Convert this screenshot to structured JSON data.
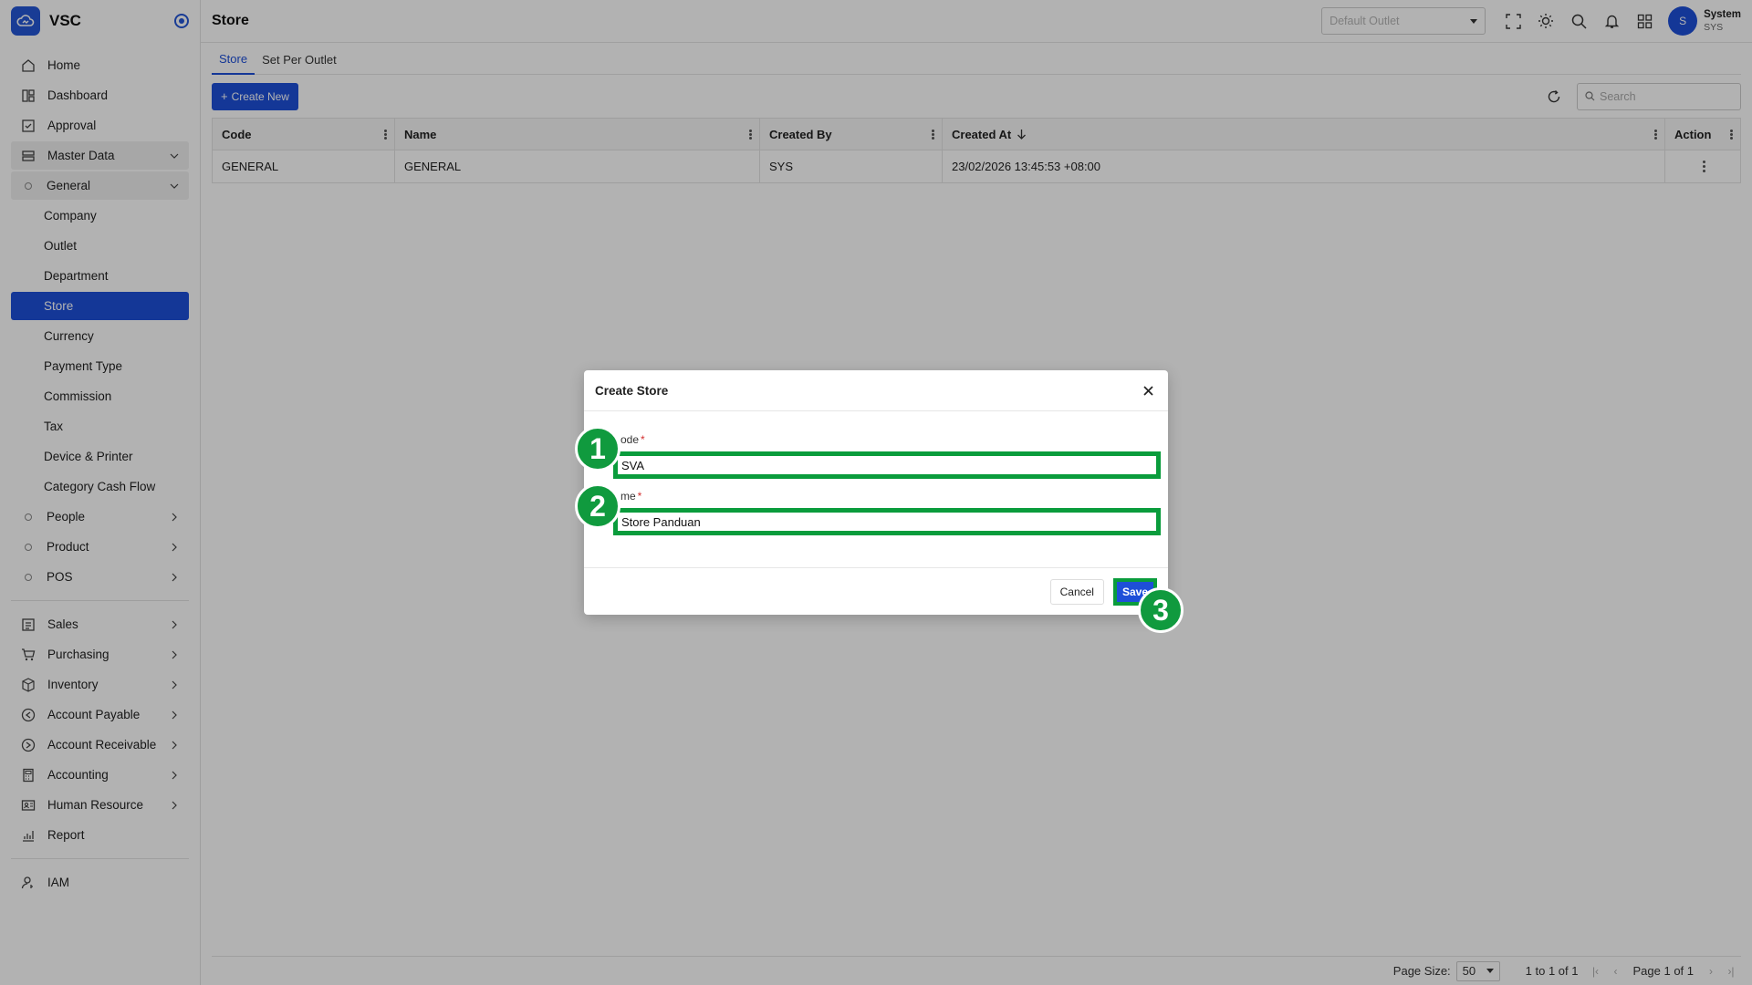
{
  "brand": {
    "name": "VSC"
  },
  "sidebar": {
    "items": [
      {
        "label": "Home",
        "icon": "home-icon"
      },
      {
        "label": "Dashboard",
        "icon": "dashboard-icon"
      },
      {
        "label": "Approval",
        "icon": "approval-icon"
      },
      {
        "label": "Master Data",
        "icon": "master-data-icon"
      },
      {
        "label": "General"
      },
      {
        "label": "Company"
      },
      {
        "label": "Outlet"
      },
      {
        "label": "Department"
      },
      {
        "label": "Store"
      },
      {
        "label": "Currency"
      },
      {
        "label": "Payment Type"
      },
      {
        "label": "Commission"
      },
      {
        "label": "Tax"
      },
      {
        "label": "Device & Printer"
      },
      {
        "label": "Category Cash Flow"
      },
      {
        "label": "People"
      },
      {
        "label": "Product"
      },
      {
        "label": "POS"
      },
      {
        "label": "Sales",
        "icon": "sales-icon"
      },
      {
        "label": "Purchasing",
        "icon": "cart-icon"
      },
      {
        "label": "Inventory",
        "icon": "box-icon"
      },
      {
        "label": "Account Payable",
        "icon": "payable-icon"
      },
      {
        "label": "Account Receivable",
        "icon": "receivable-icon"
      },
      {
        "label": "Accounting",
        "icon": "calculator-icon"
      },
      {
        "label": "Human Resource",
        "icon": "id-card-icon"
      },
      {
        "label": "Report",
        "icon": "report-icon"
      },
      {
        "label": "IAM",
        "icon": "user-key-icon"
      }
    ]
  },
  "header": {
    "title": "Store",
    "outlet_placeholder": "Default Outlet",
    "user_name": "System",
    "user_role": "SYS",
    "avatar_initial": "S"
  },
  "tabs": [
    {
      "label": "Store"
    },
    {
      "label": "Set Per Outlet"
    }
  ],
  "toolbar": {
    "create_label": "Create New",
    "search_placeholder": "Search"
  },
  "grid": {
    "columns": [
      "Code",
      "Name",
      "Created By",
      "Created At",
      "Action"
    ],
    "rows": [
      {
        "code": "GENERAL",
        "name": "GENERAL",
        "created_by": "SYS",
        "created_at": "23/02/2026 13:45:53 +08:00"
      }
    ]
  },
  "footer": {
    "page_size_label": "Page Size:",
    "page_size_value": "50",
    "range_text": "1 to 1 of 1",
    "page_text": "Page 1 of 1"
  },
  "modal": {
    "title": "Create Store",
    "code_label": "ode",
    "code_value": "SVA",
    "name_label": "me",
    "name_value": "Store Panduan",
    "cancel_label": "Cancel",
    "save_label": "Save"
  },
  "annotations": {
    "badge1": "1",
    "badge2": "2",
    "badge3": "3"
  },
  "colors": {
    "accent": "#1e4fd8",
    "highlight": "#0a9c3c",
    "badge": "#109a3e"
  }
}
